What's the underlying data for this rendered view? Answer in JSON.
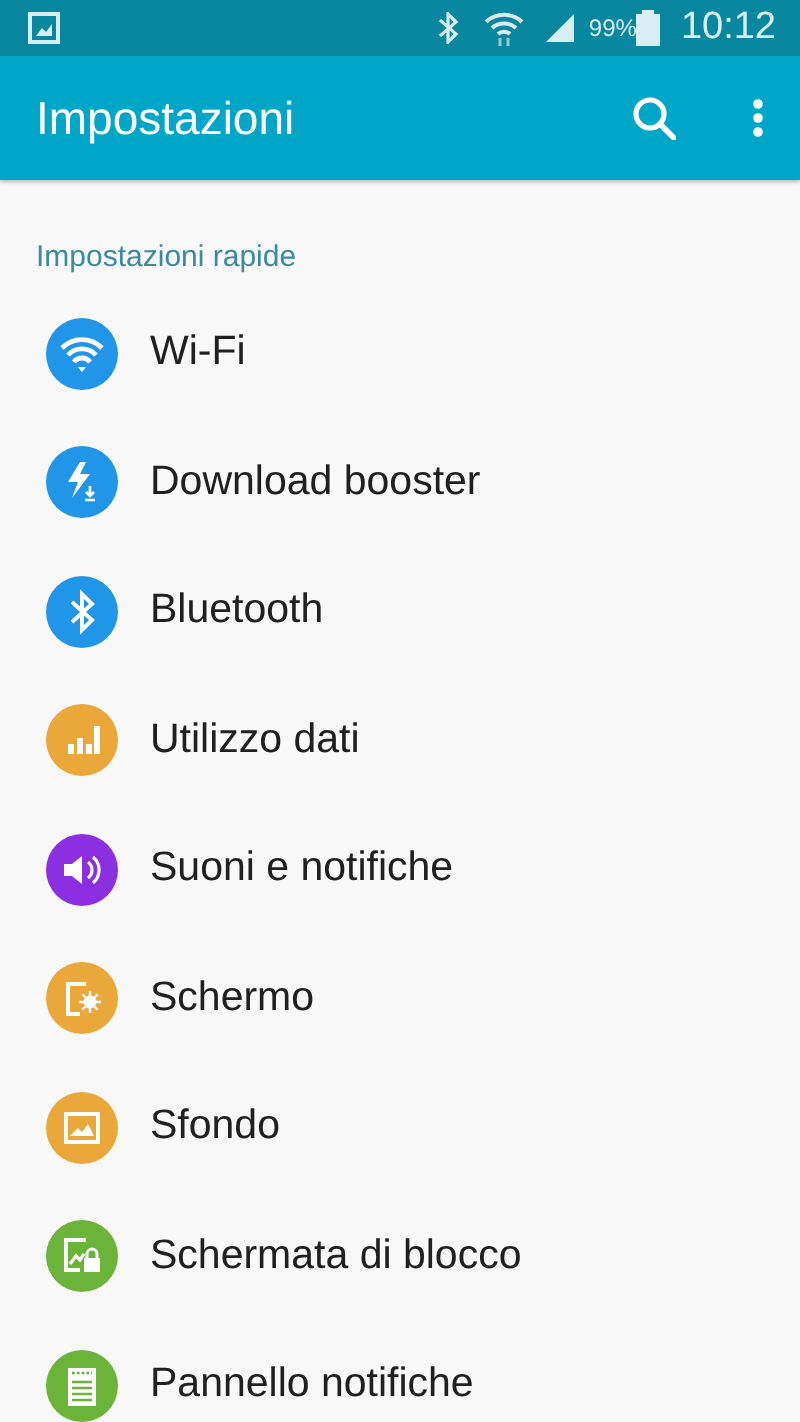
{
  "status_bar": {
    "battery": "99%",
    "time": "10:12"
  },
  "toolbar": {
    "title": "Impostazioni"
  },
  "section": {
    "title": "Impostazioni rapide"
  },
  "items": [
    {
      "label": "Wi-Fi",
      "kind": "wifi",
      "color": "#2196e8"
    },
    {
      "label": "Download booster",
      "kind": "booster",
      "color": "#2196e8"
    },
    {
      "label": "Bluetooth",
      "kind": "bluetooth",
      "color": "#2196e8"
    },
    {
      "label": "Utilizzo dati",
      "kind": "data",
      "color": "#eaa73a"
    },
    {
      "label": "Suoni e notifiche",
      "kind": "sound",
      "color": "#8b2fe0"
    },
    {
      "label": "Schermo",
      "kind": "display",
      "color": "#eaa73a"
    },
    {
      "label": "Sfondo",
      "kind": "wallpaper",
      "color": "#eaa73a"
    },
    {
      "label": "Schermata di blocco",
      "kind": "lock",
      "color": "#6cb33a"
    },
    {
      "label": "Pannello notifiche",
      "kind": "panel",
      "color": "#6cb33a"
    }
  ]
}
